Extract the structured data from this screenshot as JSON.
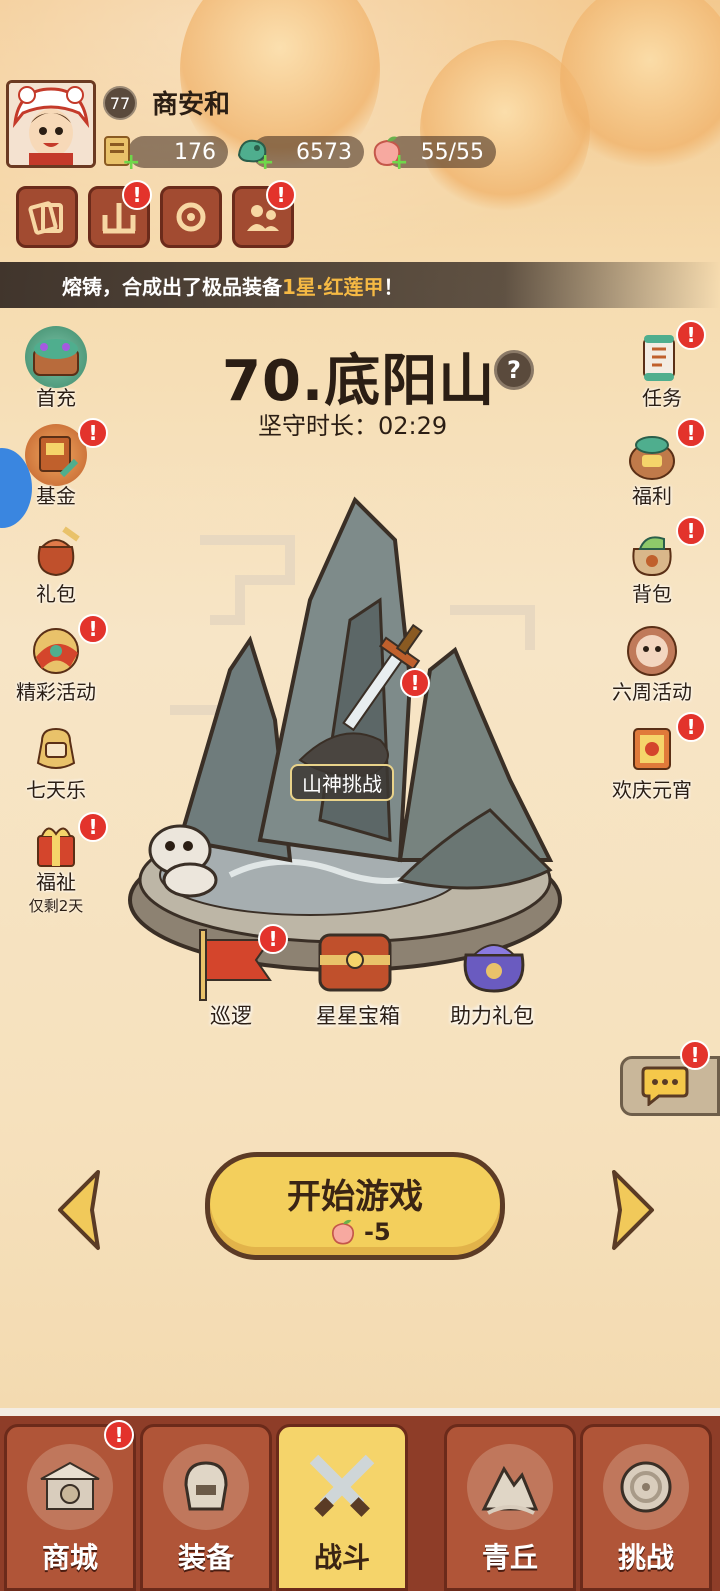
{
  "player": {
    "level": "77",
    "name": "商安和",
    "resources": [
      {
        "name": "scroll",
        "value": "176"
      },
      {
        "name": "jade",
        "value": "6573"
      },
      {
        "name": "stamina",
        "value": "55/55"
      }
    ]
  },
  "top_buttons": [
    {
      "icon": "card-icon",
      "badge": false
    },
    {
      "icon": "mountain-icon",
      "badge": true
    },
    {
      "icon": "settings-icon",
      "badge": false
    },
    {
      "icon": "friends-icon",
      "badge": true
    }
  ],
  "banner": {
    "prefix": "熔铸，合成出了极品装备",
    "highlight": "1星·红莲甲",
    "suffix": "！"
  },
  "left_menu": [
    {
      "label": "首充",
      "icon": "first-recharge-icon",
      "badge": false
    },
    {
      "label": "基金",
      "icon": "fund-icon",
      "badge": true
    },
    {
      "label": "礼包",
      "icon": "gift-bag-icon",
      "badge": false
    },
    {
      "label": "精彩活动",
      "icon": "events-icon",
      "badge": true
    },
    {
      "label": "七天乐",
      "icon": "seven-day-icon",
      "badge": false
    },
    {
      "label": "福祉",
      "sub": "仅剩2天",
      "icon": "blessing-gift-icon",
      "badge": true
    }
  ],
  "right_menu": [
    {
      "label": "任务",
      "icon": "task-scroll-icon",
      "badge": true
    },
    {
      "label": "福利",
      "icon": "welfare-icon",
      "badge": true
    },
    {
      "label": "背包",
      "icon": "backpack-icon",
      "badge": true
    },
    {
      "label": "六周活动",
      "icon": "six-week-icon",
      "badge": false
    },
    {
      "label": "欢庆元宵",
      "icon": "lantern-festival-icon",
      "badge": true
    }
  ],
  "stage": {
    "title": "70.底阳山",
    "help": "?",
    "time_label": "坚守时长：02:29"
  },
  "map_items": [
    {
      "label": "山神挑战",
      "badge": true
    },
    {
      "label": "巡逻",
      "badge": true
    },
    {
      "label": "星星宝箱",
      "badge": false
    },
    {
      "label": "助力礼包",
      "badge": false
    }
  ],
  "start_button": {
    "label": "开始游戏",
    "cost": "-5"
  },
  "nav": [
    {
      "label": "商城",
      "icon": "shop-icon",
      "active": false,
      "badge": true
    },
    {
      "label": "装备",
      "icon": "helmet-icon",
      "active": false,
      "badge": false
    },
    {
      "label": "战斗",
      "icon": "crossed-swords-icon",
      "active": true,
      "badge": false
    },
    {
      "label": "青丘",
      "icon": "qingqiu-mountain-icon",
      "active": false,
      "badge": false
    },
    {
      "label": "挑战",
      "icon": "challenge-orb-icon",
      "active": false,
      "badge": false
    }
  ],
  "badge_glyph": "!",
  "colors": {
    "accent_red": "#e3332c",
    "button_brown": "#a24b31",
    "start_yellow": "#f3cf5c",
    "banner_highlight": "#f5b944"
  }
}
